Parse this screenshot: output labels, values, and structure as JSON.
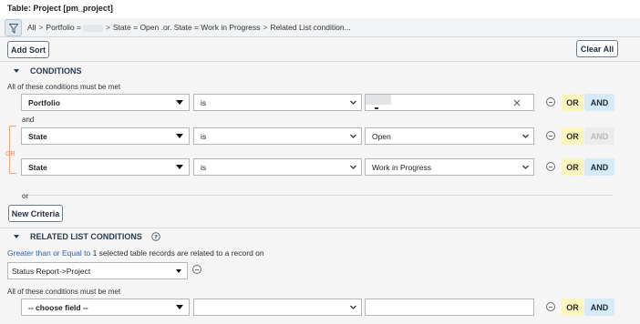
{
  "window": {
    "title": "Table: Project [pm_project]"
  },
  "breadcrumb": {
    "items": [
      "All",
      "Portfolio =",
      "State = Open .or. State = Work in Progress",
      "Related List condition..."
    ],
    "separator": ">"
  },
  "toolbar": {
    "add_sort": "Add Sort",
    "clear_all": "Clear All"
  },
  "conditions": {
    "heading": "CONDITIONS",
    "note": "All of these conditions must be met",
    "rows": [
      {
        "field": "Portfolio",
        "operator": "is",
        "value": ""
      },
      {
        "field": "State",
        "operator": "is",
        "value": "Open"
      },
      {
        "field": "State",
        "operator": "is",
        "value": "Work in Progress"
      }
    ],
    "and_text": "and",
    "or_bracket_label": "OR",
    "or_text": "or",
    "new_criteria": "New Criteria",
    "or_label": "OR",
    "and_label": "AND"
  },
  "related": {
    "heading": "RELATED LIST CONDITIONS",
    "help_icon": "question-circle-icon",
    "desc_link": "Greater than or Equal to",
    "desc_rest": "1 selected table records are related to a record on",
    "relation": "Status Report->Project",
    "note": "All of these conditions must be met",
    "row": {
      "field": "-- choose field --",
      "operator": "",
      "value": ""
    }
  },
  "colors": {
    "or_bg": "#fbf6bd",
    "and_bg": "#d6ebf8",
    "or_bracket": "#f0a680",
    "link": "#2a66a8"
  }
}
